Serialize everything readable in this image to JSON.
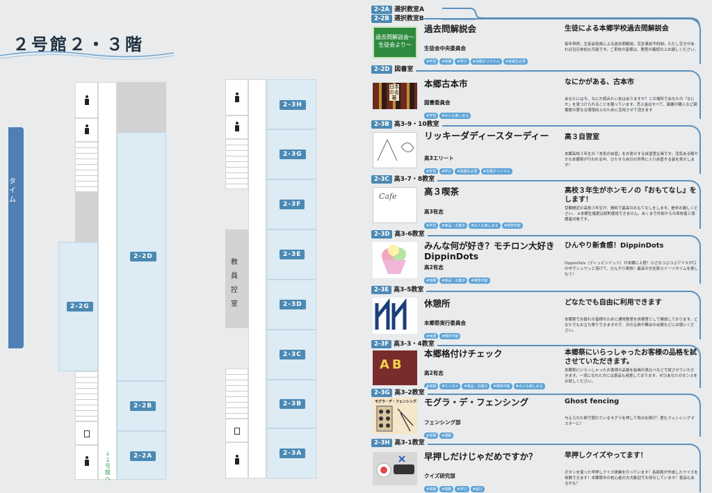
{
  "floor_title": "２号館２・３階",
  "side_tab_text": "タイム",
  "map": {
    "rooms_2f": {
      "g": "2-2G",
      "d": "2-2D",
      "b": "2-2B",
      "a": "2-2A"
    },
    "rooms_3f": {
      "h": "2-3H",
      "g": "2-3G",
      "f": "2-3F",
      "e": "2-3E",
      "d": "2-3D",
      "c": "2-3C",
      "b": "2-3B",
      "a": "2-3A"
    },
    "staff_room": "教員控室",
    "to_building1": "↓１号館へ"
  },
  "top_rooms": [
    {
      "code": "2-2A",
      "name": "選択教室A"
    },
    {
      "code": "2-2B",
      "name": "選択教室B"
    }
  ],
  "events": [
    {
      "code": "",
      "room": "",
      "title": "過去問解説会",
      "org": "生徒会中央委員会",
      "tags": [
        "#学習",
        "#体験",
        "#学び",
        "#本郷オリジナル",
        "#受験生必見"
      ],
      "subtitle": "生徒による本郷学校過去問解説会",
      "desc": "毎年恒例、生徒会役員による過去問解説。完全事前予約制。ただし空きがあれば当日参加も可能です。ご来校の皆様は、教室の確認の上お越しください。",
      "thumb": "過去問解説会〜生徒会より〜"
    },
    {
      "code": "2-2D",
      "room": "図書室",
      "title": "本郷古本市",
      "org": "図書委員会",
      "tags": [
        "#学習",
        "#大人も楽しめる"
      ],
      "subtitle": "なにかがある、古本市",
      "desc": "あなたには今、なにか読みたい本はありますか？この場所であなたの「なにか」を見つけられることを願っています。売上金はすべて、図書の購入など図書館の更なる環境向上のために活用させて頂きます",
      "thumb": "日本の名著"
    },
    {
      "code": "2-3B",
      "room": "高3-9・10教室",
      "title": "リッキーダディースターディー",
      "org": "高3エリート",
      "tags": [
        "#学習",
        "#学び",
        "#受験生必見",
        "#本郷オリジナル"
      ],
      "subtitle": "高３自習室",
      "desc": "本郷高校３年生の「本気の自習」をお見せする自習室企画です。活気ある賑やかな本郷祭が行われる中、ひたすら自分の世界に入り自習する姿を見せします！",
      "thumb": ""
    },
    {
      "code": "2-3C",
      "room": "高3-7・8教室",
      "title": "高３喫茶",
      "org": "高3有志",
      "tags": [
        "#学習",
        "#食品・お菓子",
        "#大人も楽しめる",
        "#喫茶可能"
      ],
      "subtitle": "高校３年生がホンモノの『おもてなし』をします！",
      "desc": "受験間近の高校３年生が、無料で最高のおもてなしをします。是非お越しください。 ※本郷生諸君は原則使用できません。あくまで外部からの来校者と保護者対象です。",
      "thumb": "Cafe"
    },
    {
      "code": "2-3D",
      "room": "高3-6教室",
      "title": "みんな何が好き？モチロン大好きDippinDots",
      "org": "高2有志",
      "tags": [
        "#体験",
        "#食品・お菓子",
        "#喫茶可能"
      ],
      "subtitle": "ひんやり新食感！DippinDots",
      "desc": "DippinDots（ディッピンドッツ）が本郷に上陸！小さなつぶつぶアイスが口の中でシュワッと溶けて、ひんやり爽快！最高の文化祭スイーツタイムを楽しもう！",
      "thumb": ""
    },
    {
      "code": "2-3E",
      "room": "高3-5教室",
      "title": "休憩所",
      "org": "本郷祭実行委員会",
      "tags": [
        "#休憩",
        "#喫茶可能"
      ],
      "subtitle": "どなたでも自由に利用できます",
      "desc": "本郷祭でお疲れの皆様のために通常教室を休憩室として開放しております。どなたでもお立ち寄りできますので、次の企画や舞台の合間などにお使いください。",
      "thumb": ""
    },
    {
      "code": "2-3F",
      "room": "高3-3・4教室",
      "title": "本郷格付けチェック",
      "org": "高2有志",
      "tags": [
        "#体験",
        "#エンタメ",
        "#食品・お菓子",
        "#喫茶可能",
        "#大人も楽しめる"
      ],
      "subtitle": "本郷祭にいらっしゃったお客様の品格を試させていただきます。",
      "desc": "本郷祭にいらっしゃったお客様の品格を絵画の見比べなどで試させていただきます。一流になれた方には景品も用意しております。ぜひあなたのセンスをお試しください。",
      "thumb": "AB"
    },
    {
      "code": "2-3G",
      "room": "高3-2教室",
      "title": "モグラ・デ・フェンシング",
      "org": "フェンシング部",
      "tags": [
        "#体験",
        "#運動"
      ],
      "subtitle": "Ghost fencing",
      "desc": "与えられた剣で隠れているモグラを押して得点を稼げ！君もフェンシングマスターに！",
      "thumb": "モグラ・デ・フェンシング！"
    },
    {
      "code": "2-3H",
      "room": "高3-1教室",
      "title": "早押しだけじゃだめですか？",
      "org": "クイズ研究部",
      "tags": [
        "#体験",
        "#運動",
        "#学び",
        "#遊び"
      ],
      "subtitle": "早押しクイズやってます！",
      "desc": "ボタンを使った早押しクイズ体験を行っています！各部員が作成したクイズを体験できます！本郷祭中の校心者の方大歓迎でお待ちしています！景品もあるかも？",
      "thumb": ""
    }
  ]
}
